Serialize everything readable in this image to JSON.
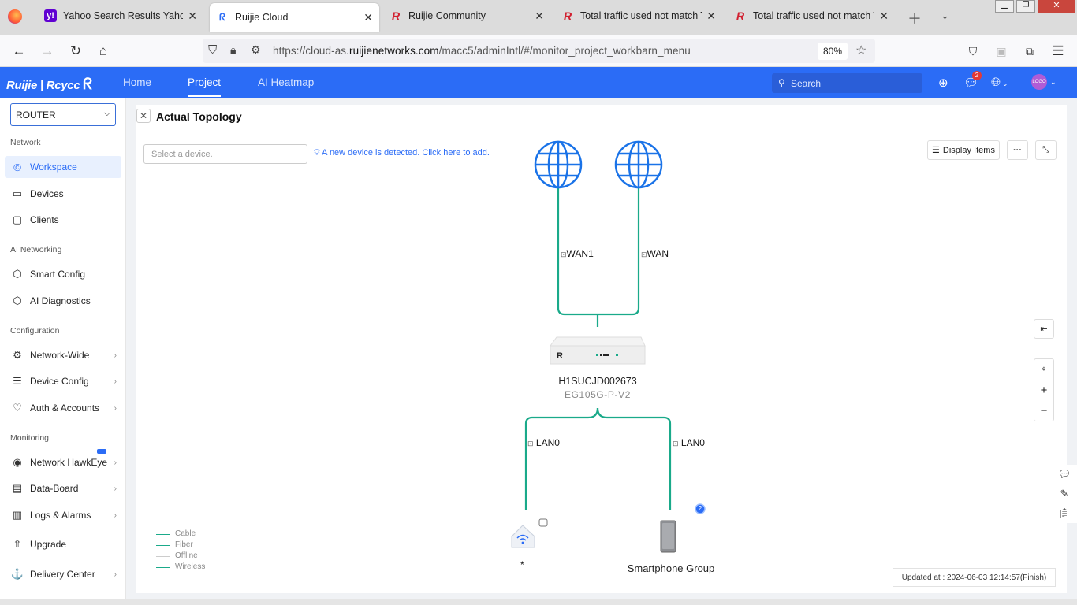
{
  "browser": {
    "tabs": [
      {
        "title": "Yahoo Search Results Yahoo -",
        "icon": "yahoo-icon",
        "active": false
      },
      {
        "title": "Ruijie Cloud",
        "icon": "ruijie-cloud-icon",
        "active": true
      },
      {
        "title": "Ruijie Community",
        "icon": "ruijie-r-icon",
        "active": false
      },
      {
        "title": "Total traffic used not match To",
        "icon": "ruijie-r-icon",
        "active": false
      },
      {
        "title": "Total traffic used not match To",
        "icon": "ruijie-r-icon",
        "active": false
      }
    ],
    "url_prefix": "https://cloud-as.",
    "url_domain": "ruijienetworks.com",
    "url_path": "/macc5/adminIntl/#/monitor_project_workbarn_menu",
    "zoom": "80%"
  },
  "header": {
    "logo": "Ruijie | Rcycc",
    "menu": [
      "Home",
      "Project",
      "AI Heatmap"
    ],
    "active_menu": "Project",
    "search_placeholder": "Search",
    "notification_count": "2",
    "avatar_text": "LOGO"
  },
  "sidebar": {
    "device_select": "ROUTER",
    "sections": [
      {
        "title": "Network",
        "items": [
          {
            "label": "Workspace",
            "icon": "workspace-icon",
            "active": true,
            "chevron": false
          },
          {
            "label": "Devices",
            "icon": "devices-icon",
            "active": false,
            "chevron": false
          },
          {
            "label": "Clients",
            "icon": "clients-icon",
            "active": false,
            "chevron": false
          }
        ]
      },
      {
        "title": "AI Networking",
        "items": [
          {
            "label": "Smart Config",
            "icon": "smart-config-icon",
            "active": false,
            "chevron": false
          },
          {
            "label": "AI Diagnostics",
            "icon": "ai-diagnostics-icon",
            "active": false,
            "chevron": false
          }
        ]
      },
      {
        "title": "Configuration",
        "items": [
          {
            "label": "Network-Wide",
            "icon": "gear-icon",
            "active": false,
            "chevron": true
          },
          {
            "label": "Device Config",
            "icon": "sliders-icon",
            "active": false,
            "chevron": true
          },
          {
            "label": "Auth & Accounts",
            "icon": "shield-icon",
            "active": false,
            "chevron": true
          }
        ]
      },
      {
        "title": "Monitoring",
        "items": [
          {
            "label": "Network HawkEye",
            "icon": "eye-icon",
            "active": false,
            "chevron": true
          },
          {
            "label": "Data-Board",
            "icon": "dashboard-icon",
            "active": false,
            "chevron": true
          },
          {
            "label": "Logs & Alarms",
            "icon": "logs-icon",
            "active": false,
            "chevron": true
          },
          {
            "label": "Upgrade",
            "icon": "upgrade-icon",
            "active": false,
            "chevron": false
          },
          {
            "label": "Delivery Center",
            "icon": "delivery-icon",
            "active": false,
            "chevron": true
          }
        ]
      }
    ]
  },
  "topology": {
    "title": "Actual Topology",
    "device_select_placeholder": "Select a device.",
    "new_device_notice": "A new device is detected. Click here to add.",
    "display_items_label": "Display Items",
    "wan_links": [
      "WAN1",
      "WAN"
    ],
    "router": {
      "sn": "H1SUCJD002673",
      "model": "EG105G-P-V2"
    },
    "lan_links": [
      "LAN0",
      "LAN0"
    ],
    "clients": [
      {
        "label": "*",
        "icon": "wireless-ap-icon"
      },
      {
        "label": "Smartphone Group",
        "icon": "smartphone-icon",
        "badge": "2"
      }
    ],
    "legend": [
      {
        "label": "Cable",
        "color": "#1aaa8a"
      },
      {
        "label": "Fiber",
        "color": "#1aaa8a"
      },
      {
        "label": "Offline",
        "color": "#cccccc"
      },
      {
        "label": "Wireless",
        "color": "#1aaa8a"
      }
    ],
    "updated": "Updated at : 2024-06-03 12:14:57(Finish)",
    "link_color": "#1aaa8a",
    "globe_color": "#1a73e8"
  }
}
